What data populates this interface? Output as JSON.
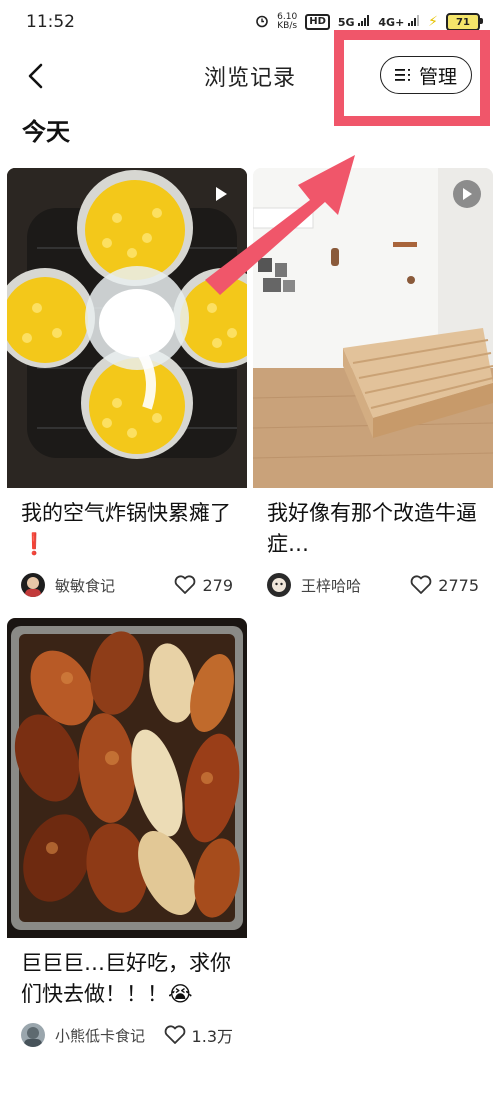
{
  "status_bar": {
    "time": "11:52",
    "net_speed_value": "6.10",
    "net_speed_unit": "KB/s",
    "hd_label": "HD",
    "signal_5g": "5G",
    "signal_4g": "4G+",
    "battery": "71"
  },
  "header": {
    "title": "浏览记录",
    "manage_label": "管理"
  },
  "section": {
    "title": "今天"
  },
  "cards": [
    {
      "title": "我的空气炸锅快累瘫了❗",
      "author": "敏敏食记",
      "likes": "279",
      "is_video": true
    },
    {
      "title": "我好像有那个改造牛逼症…",
      "author": "王梓哈哈",
      "likes": "2775",
      "is_video": true
    },
    {
      "title": "巨巨巨…巨好吃，求你们快去做！！！😭",
      "author": "小熊低卡食记",
      "likes": "1.3万",
      "is_video": false
    }
  ],
  "colors": {
    "annotation": "#f0566a",
    "text_primary": "#111111",
    "text_secondary": "#444444"
  }
}
